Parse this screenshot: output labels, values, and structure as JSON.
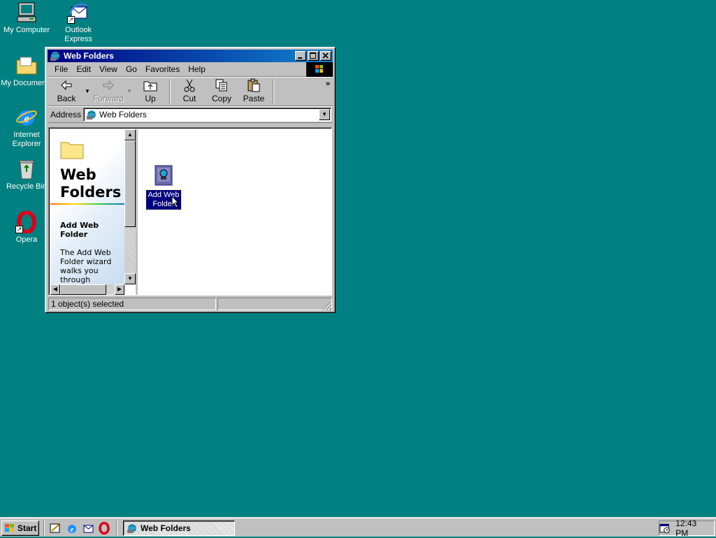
{
  "desktop": {
    "background_color": "#008080",
    "icons": [
      {
        "label": "My Computer",
        "icon": "my-computer-icon"
      },
      {
        "label": "Outlook Express",
        "icon": "outlook-express-icon"
      },
      {
        "label": "My Documents",
        "icon": "my-documents-icon"
      },
      {
        "label": "Internet Explorer",
        "icon": "internet-explorer-icon"
      },
      {
        "label": "Recycle Bin",
        "icon": "recycle-bin-icon"
      },
      {
        "label": "Opera",
        "icon": "opera-icon"
      }
    ]
  },
  "window": {
    "title": "Web Folders",
    "menu": [
      "File",
      "Edit",
      "View",
      "Go",
      "Favorites",
      "Help"
    ],
    "toolbar": {
      "back": "Back",
      "forward": "Forward",
      "up": "Up",
      "cut": "Cut",
      "copy": "Copy",
      "paste": "Paste"
    },
    "address": {
      "label": "Address",
      "value": "Web Folders"
    },
    "info_pane": {
      "title": "Web Folders",
      "subtitle": "Add Web Folder",
      "description": "The Add Web Folder wizard walks you through"
    },
    "items": [
      {
        "label": "Add Web Folder",
        "icon": "add-web-folder-icon",
        "selected": true
      }
    ],
    "status": {
      "text": "1 object(s) selected"
    }
  },
  "taskbar": {
    "start_label": "Start",
    "quick_launch": [
      "show-desktop-icon",
      "internet-explorer-icon",
      "outlook-express-icon",
      "opera-icon"
    ],
    "task_button": "Web Folders",
    "clock": "12:43 PM"
  }
}
